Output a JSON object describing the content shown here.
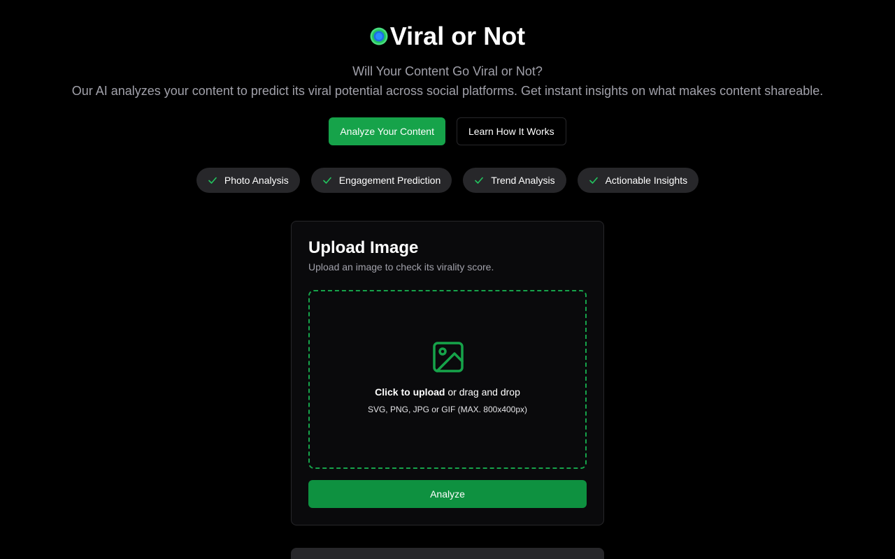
{
  "header": {
    "title": "Viral or Not",
    "subtitle": "Will Your Content Go Viral or Not?",
    "description": "Our AI analyzes your content to predict its viral potential across social platforms. Get instant insights on what makes content shareable."
  },
  "cta": {
    "primary_label": "Analyze Your Content",
    "secondary_label": "Learn How It Works"
  },
  "features": [
    {
      "label": "Photo Analysis",
      "icon": "check-icon"
    },
    {
      "label": "Engagement Prediction",
      "icon": "check-icon"
    },
    {
      "label": "Trend Analysis",
      "icon": "check-icon"
    },
    {
      "label": "Actionable Insights",
      "icon": "check-icon"
    }
  ],
  "upload_card": {
    "title": "Upload Image",
    "description": "Upload an image to check its virality score.",
    "dropzone_icon": "image-icon",
    "click_text": "Click to upload",
    "drag_text": " or drag and drop",
    "hint": "SVG, PNG, JPG or GIF (MAX. 800x400px)",
    "analyze_label": "Analyze"
  },
  "colors": {
    "background": "#000000",
    "accent": "#16a34a",
    "card": "#0a0a0c",
    "pill": "#27272a",
    "muted_text": "#a1a1aa"
  }
}
